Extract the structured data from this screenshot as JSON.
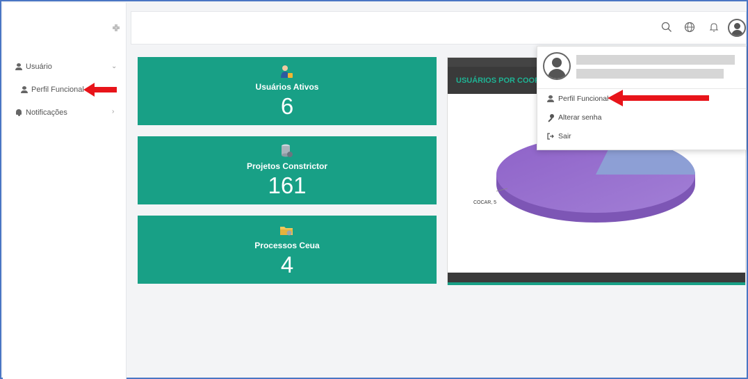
{
  "sidebar": {
    "items": [
      {
        "label": "Usuário",
        "icon": "user-icon",
        "chevron": "⌄"
      },
      {
        "label": "Perfil Funcional",
        "icon": "user-icon"
      },
      {
        "label": "Notificações",
        "icon": "bell-icon",
        "chevron": "›"
      }
    ]
  },
  "topbar": {
    "icons": [
      "search-icon",
      "globe-icon",
      "bell-icon",
      "avatar"
    ]
  },
  "cards": [
    {
      "title": "Usuários Ativos",
      "value": "6",
      "icon": "users-icon"
    },
    {
      "title": "Projetos Constrictor",
      "value": "161",
      "icon": "database-icon"
    },
    {
      "title": "Processos Ceua",
      "value": "4",
      "icon": "folder-icon"
    }
  ],
  "chart": {
    "title": "USUÁRIOS POR COOR",
    "slice_label": "COCAR, 5"
  },
  "chart_data": {
    "type": "pie",
    "title": "USUÁRIOS POR COOR",
    "categories": [
      "COCAR"
    ],
    "values": [
      5
    ]
  },
  "dropdown": {
    "items": [
      {
        "label": "Perfil Funcional",
        "icon": "user-icon"
      },
      {
        "label": "Alterar senha",
        "icon": "key-icon"
      },
      {
        "label": "Sair",
        "icon": "sign-out-icon"
      }
    ]
  },
  "colors": {
    "card": "#18a086",
    "arrow": "#e8141a",
    "pie_main": "#9a72cc",
    "pie_slice": "#8a9bd0"
  }
}
